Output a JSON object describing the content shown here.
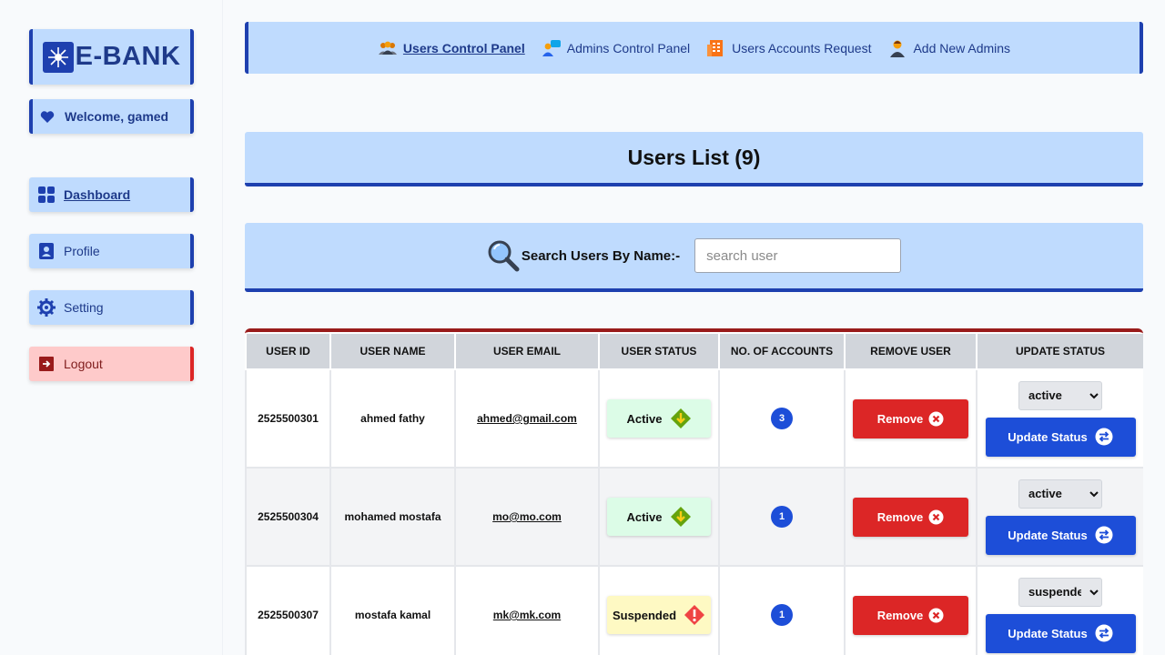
{
  "brand": {
    "name": "E-BANK"
  },
  "sidebar": {
    "welcome": "Welcome, gamed",
    "items": [
      {
        "label": "Dashboard",
        "icon": "grid-icon"
      },
      {
        "label": "Profile",
        "icon": "user-card-icon"
      },
      {
        "label": "Setting",
        "icon": "gear-icon"
      },
      {
        "label": "Logout",
        "icon": "logout-icon"
      }
    ]
  },
  "topnav": {
    "items": [
      {
        "label": "Users Control Panel",
        "icon": "users-icon",
        "active": true
      },
      {
        "label": "Admins Control Panel",
        "icon": "admins-chat-icon"
      },
      {
        "label": "Users Accounts Request",
        "icon": "building-icon"
      },
      {
        "label": "Add New Admins",
        "icon": "person-icon"
      }
    ]
  },
  "title": "Users List (9)",
  "search": {
    "label": "Search Users By Name:-",
    "placeholder": "search user",
    "value": ""
  },
  "table": {
    "headers": [
      "USER ID",
      "USER NAME",
      "USER EMAIL",
      "USER STATUS",
      "NO. OF ACCOUNTS",
      "REMOVE USER",
      "UPDATE STATUS"
    ],
    "remove_label": "Remove",
    "update_label": "Update Status",
    "rows": [
      {
        "id": "2525500301",
        "name": "ahmed fathy",
        "email": "ahmed@gmail.com",
        "status": "Active",
        "accounts": "3",
        "select": "active"
      },
      {
        "id": "2525500304",
        "name": "mohamed mostafa",
        "email": "mo@mo.com",
        "status": "Active",
        "accounts": "1",
        "select": "active"
      },
      {
        "id": "2525500307",
        "name": "mostafa kamal",
        "email": "mk@mk.com",
        "status": "Suspended",
        "accounts": "1",
        "select": "suspended"
      }
    ]
  },
  "colors": {
    "accent": "#1e40af",
    "panel": "#bfdbfe",
    "danger": "#dc2626",
    "primary_button": "#1d4ed8"
  }
}
